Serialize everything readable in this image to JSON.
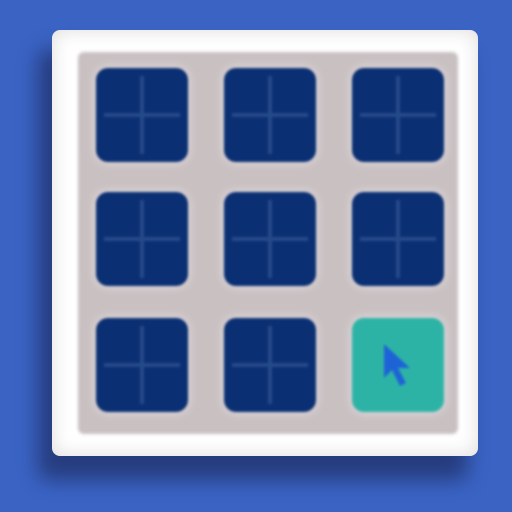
{
  "icon": {
    "name": "grid-app-icon",
    "rows": 3,
    "columns": 3,
    "active_tile": "bottom-right"
  },
  "colors": {
    "background": "#3a63c4",
    "panel": "#ffffff",
    "grid_gap": "#c9c0c2",
    "tile": "#0b2f73",
    "tile_active": "#2db3a6",
    "pointer": "#1e63d6"
  },
  "tiles": [
    {
      "id": "tile-1",
      "state": "normal"
    },
    {
      "id": "tile-2",
      "state": "normal"
    },
    {
      "id": "tile-3",
      "state": "normal"
    },
    {
      "id": "tile-4",
      "state": "normal"
    },
    {
      "id": "tile-5",
      "state": "normal"
    },
    {
      "id": "tile-6",
      "state": "normal"
    },
    {
      "id": "tile-7",
      "state": "normal"
    },
    {
      "id": "tile-8",
      "state": "normal"
    },
    {
      "id": "tile-9",
      "state": "active"
    }
  ]
}
